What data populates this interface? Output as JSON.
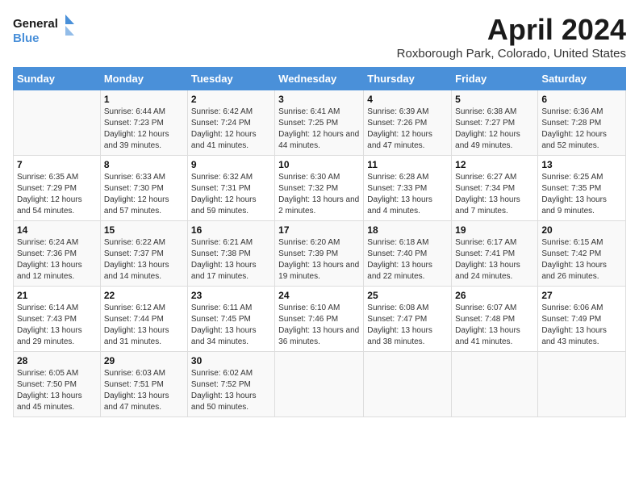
{
  "header": {
    "logo_line1": "General",
    "logo_line2": "Blue",
    "month": "April 2024",
    "location": "Roxborough Park, Colorado, United States"
  },
  "weekdays": [
    "Sunday",
    "Monday",
    "Tuesday",
    "Wednesday",
    "Thursday",
    "Friday",
    "Saturday"
  ],
  "weeks": [
    [
      {
        "day": "",
        "sunrise": "",
        "sunset": "",
        "daylight": ""
      },
      {
        "day": "1",
        "sunrise": "6:44 AM",
        "sunset": "7:23 PM",
        "daylight": "12 hours and 39 minutes."
      },
      {
        "day": "2",
        "sunrise": "6:42 AM",
        "sunset": "7:24 PM",
        "daylight": "12 hours and 41 minutes."
      },
      {
        "day": "3",
        "sunrise": "6:41 AM",
        "sunset": "7:25 PM",
        "daylight": "12 hours and 44 minutes."
      },
      {
        "day": "4",
        "sunrise": "6:39 AM",
        "sunset": "7:26 PM",
        "daylight": "12 hours and 47 minutes."
      },
      {
        "day": "5",
        "sunrise": "6:38 AM",
        "sunset": "7:27 PM",
        "daylight": "12 hours and 49 minutes."
      },
      {
        "day": "6",
        "sunrise": "6:36 AM",
        "sunset": "7:28 PM",
        "daylight": "12 hours and 52 minutes."
      }
    ],
    [
      {
        "day": "7",
        "sunrise": "6:35 AM",
        "sunset": "7:29 PM",
        "daylight": "12 hours and 54 minutes."
      },
      {
        "day": "8",
        "sunrise": "6:33 AM",
        "sunset": "7:30 PM",
        "daylight": "12 hours and 57 minutes."
      },
      {
        "day": "9",
        "sunrise": "6:32 AM",
        "sunset": "7:31 PM",
        "daylight": "12 hours and 59 minutes."
      },
      {
        "day": "10",
        "sunrise": "6:30 AM",
        "sunset": "7:32 PM",
        "daylight": "13 hours and 2 minutes."
      },
      {
        "day": "11",
        "sunrise": "6:28 AM",
        "sunset": "7:33 PM",
        "daylight": "13 hours and 4 minutes."
      },
      {
        "day": "12",
        "sunrise": "6:27 AM",
        "sunset": "7:34 PM",
        "daylight": "13 hours and 7 minutes."
      },
      {
        "day": "13",
        "sunrise": "6:25 AM",
        "sunset": "7:35 PM",
        "daylight": "13 hours and 9 minutes."
      }
    ],
    [
      {
        "day": "14",
        "sunrise": "6:24 AM",
        "sunset": "7:36 PM",
        "daylight": "13 hours and 12 minutes."
      },
      {
        "day": "15",
        "sunrise": "6:22 AM",
        "sunset": "7:37 PM",
        "daylight": "13 hours and 14 minutes."
      },
      {
        "day": "16",
        "sunrise": "6:21 AM",
        "sunset": "7:38 PM",
        "daylight": "13 hours and 17 minutes."
      },
      {
        "day": "17",
        "sunrise": "6:20 AM",
        "sunset": "7:39 PM",
        "daylight": "13 hours and 19 minutes."
      },
      {
        "day": "18",
        "sunrise": "6:18 AM",
        "sunset": "7:40 PM",
        "daylight": "13 hours and 22 minutes."
      },
      {
        "day": "19",
        "sunrise": "6:17 AM",
        "sunset": "7:41 PM",
        "daylight": "13 hours and 24 minutes."
      },
      {
        "day": "20",
        "sunrise": "6:15 AM",
        "sunset": "7:42 PM",
        "daylight": "13 hours and 26 minutes."
      }
    ],
    [
      {
        "day": "21",
        "sunrise": "6:14 AM",
        "sunset": "7:43 PM",
        "daylight": "13 hours and 29 minutes."
      },
      {
        "day": "22",
        "sunrise": "6:12 AM",
        "sunset": "7:44 PM",
        "daylight": "13 hours and 31 minutes."
      },
      {
        "day": "23",
        "sunrise": "6:11 AM",
        "sunset": "7:45 PM",
        "daylight": "13 hours and 34 minutes."
      },
      {
        "day": "24",
        "sunrise": "6:10 AM",
        "sunset": "7:46 PM",
        "daylight": "13 hours and 36 minutes."
      },
      {
        "day": "25",
        "sunrise": "6:08 AM",
        "sunset": "7:47 PM",
        "daylight": "13 hours and 38 minutes."
      },
      {
        "day": "26",
        "sunrise": "6:07 AM",
        "sunset": "7:48 PM",
        "daylight": "13 hours and 41 minutes."
      },
      {
        "day": "27",
        "sunrise": "6:06 AM",
        "sunset": "7:49 PM",
        "daylight": "13 hours and 43 minutes."
      }
    ],
    [
      {
        "day": "28",
        "sunrise": "6:05 AM",
        "sunset": "7:50 PM",
        "daylight": "13 hours and 45 minutes."
      },
      {
        "day": "29",
        "sunrise": "6:03 AM",
        "sunset": "7:51 PM",
        "daylight": "13 hours and 47 minutes."
      },
      {
        "day": "30",
        "sunrise": "6:02 AM",
        "sunset": "7:52 PM",
        "daylight": "13 hours and 50 minutes."
      },
      {
        "day": "",
        "sunrise": "",
        "sunset": "",
        "daylight": ""
      },
      {
        "day": "",
        "sunrise": "",
        "sunset": "",
        "daylight": ""
      },
      {
        "day": "",
        "sunrise": "",
        "sunset": "",
        "daylight": ""
      },
      {
        "day": "",
        "sunrise": "",
        "sunset": "",
        "daylight": ""
      }
    ]
  ]
}
